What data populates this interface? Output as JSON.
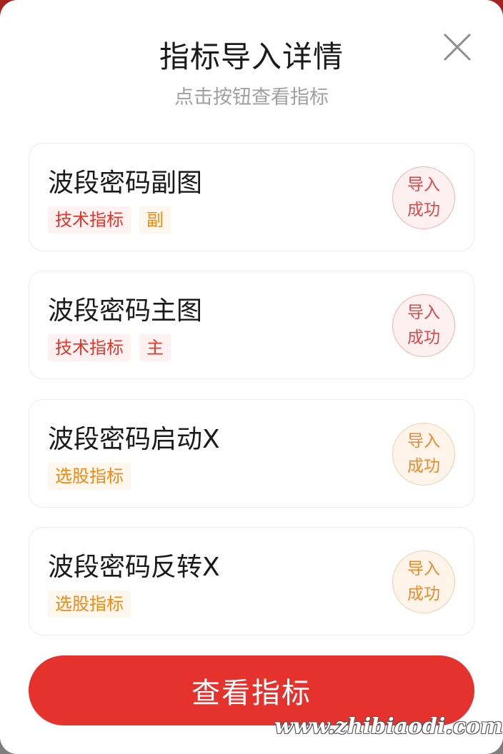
{
  "dialog": {
    "title": "指标导入详情",
    "subtitle": "点击按钮查看指标"
  },
  "cards": [
    {
      "name": "波段密码副图",
      "tags": [
        {
          "text": "技术指标",
          "color": "red"
        },
        {
          "text": "副",
          "color": "orange"
        }
      ],
      "status": {
        "line1": "导入",
        "line2": "成功",
        "color": "red"
      }
    },
    {
      "name": "波段密码主图",
      "tags": [
        {
          "text": "技术指标",
          "color": "red"
        },
        {
          "text": "主",
          "color": "red"
        }
      ],
      "status": {
        "line1": "导入",
        "line2": "成功",
        "color": "red"
      }
    },
    {
      "name": "波段密码启动X",
      "tags": [
        {
          "text": "选股指标",
          "color": "orange"
        }
      ],
      "status": {
        "line1": "导入",
        "line2": "成功",
        "color": "orange"
      }
    },
    {
      "name": "波段密码反转X",
      "tags": [
        {
          "text": "选股指标",
          "color": "orange"
        }
      ],
      "status": {
        "line1": "导入",
        "line2": "成功",
        "color": "orange"
      }
    }
  ],
  "primary_button": {
    "label": "查看指标"
  },
  "watermark": "www.zhibiaodi.com",
  "colors": {
    "accent_red": "#e5322d",
    "tag_red": "#e0382c",
    "tag_orange": "#f08a15"
  }
}
